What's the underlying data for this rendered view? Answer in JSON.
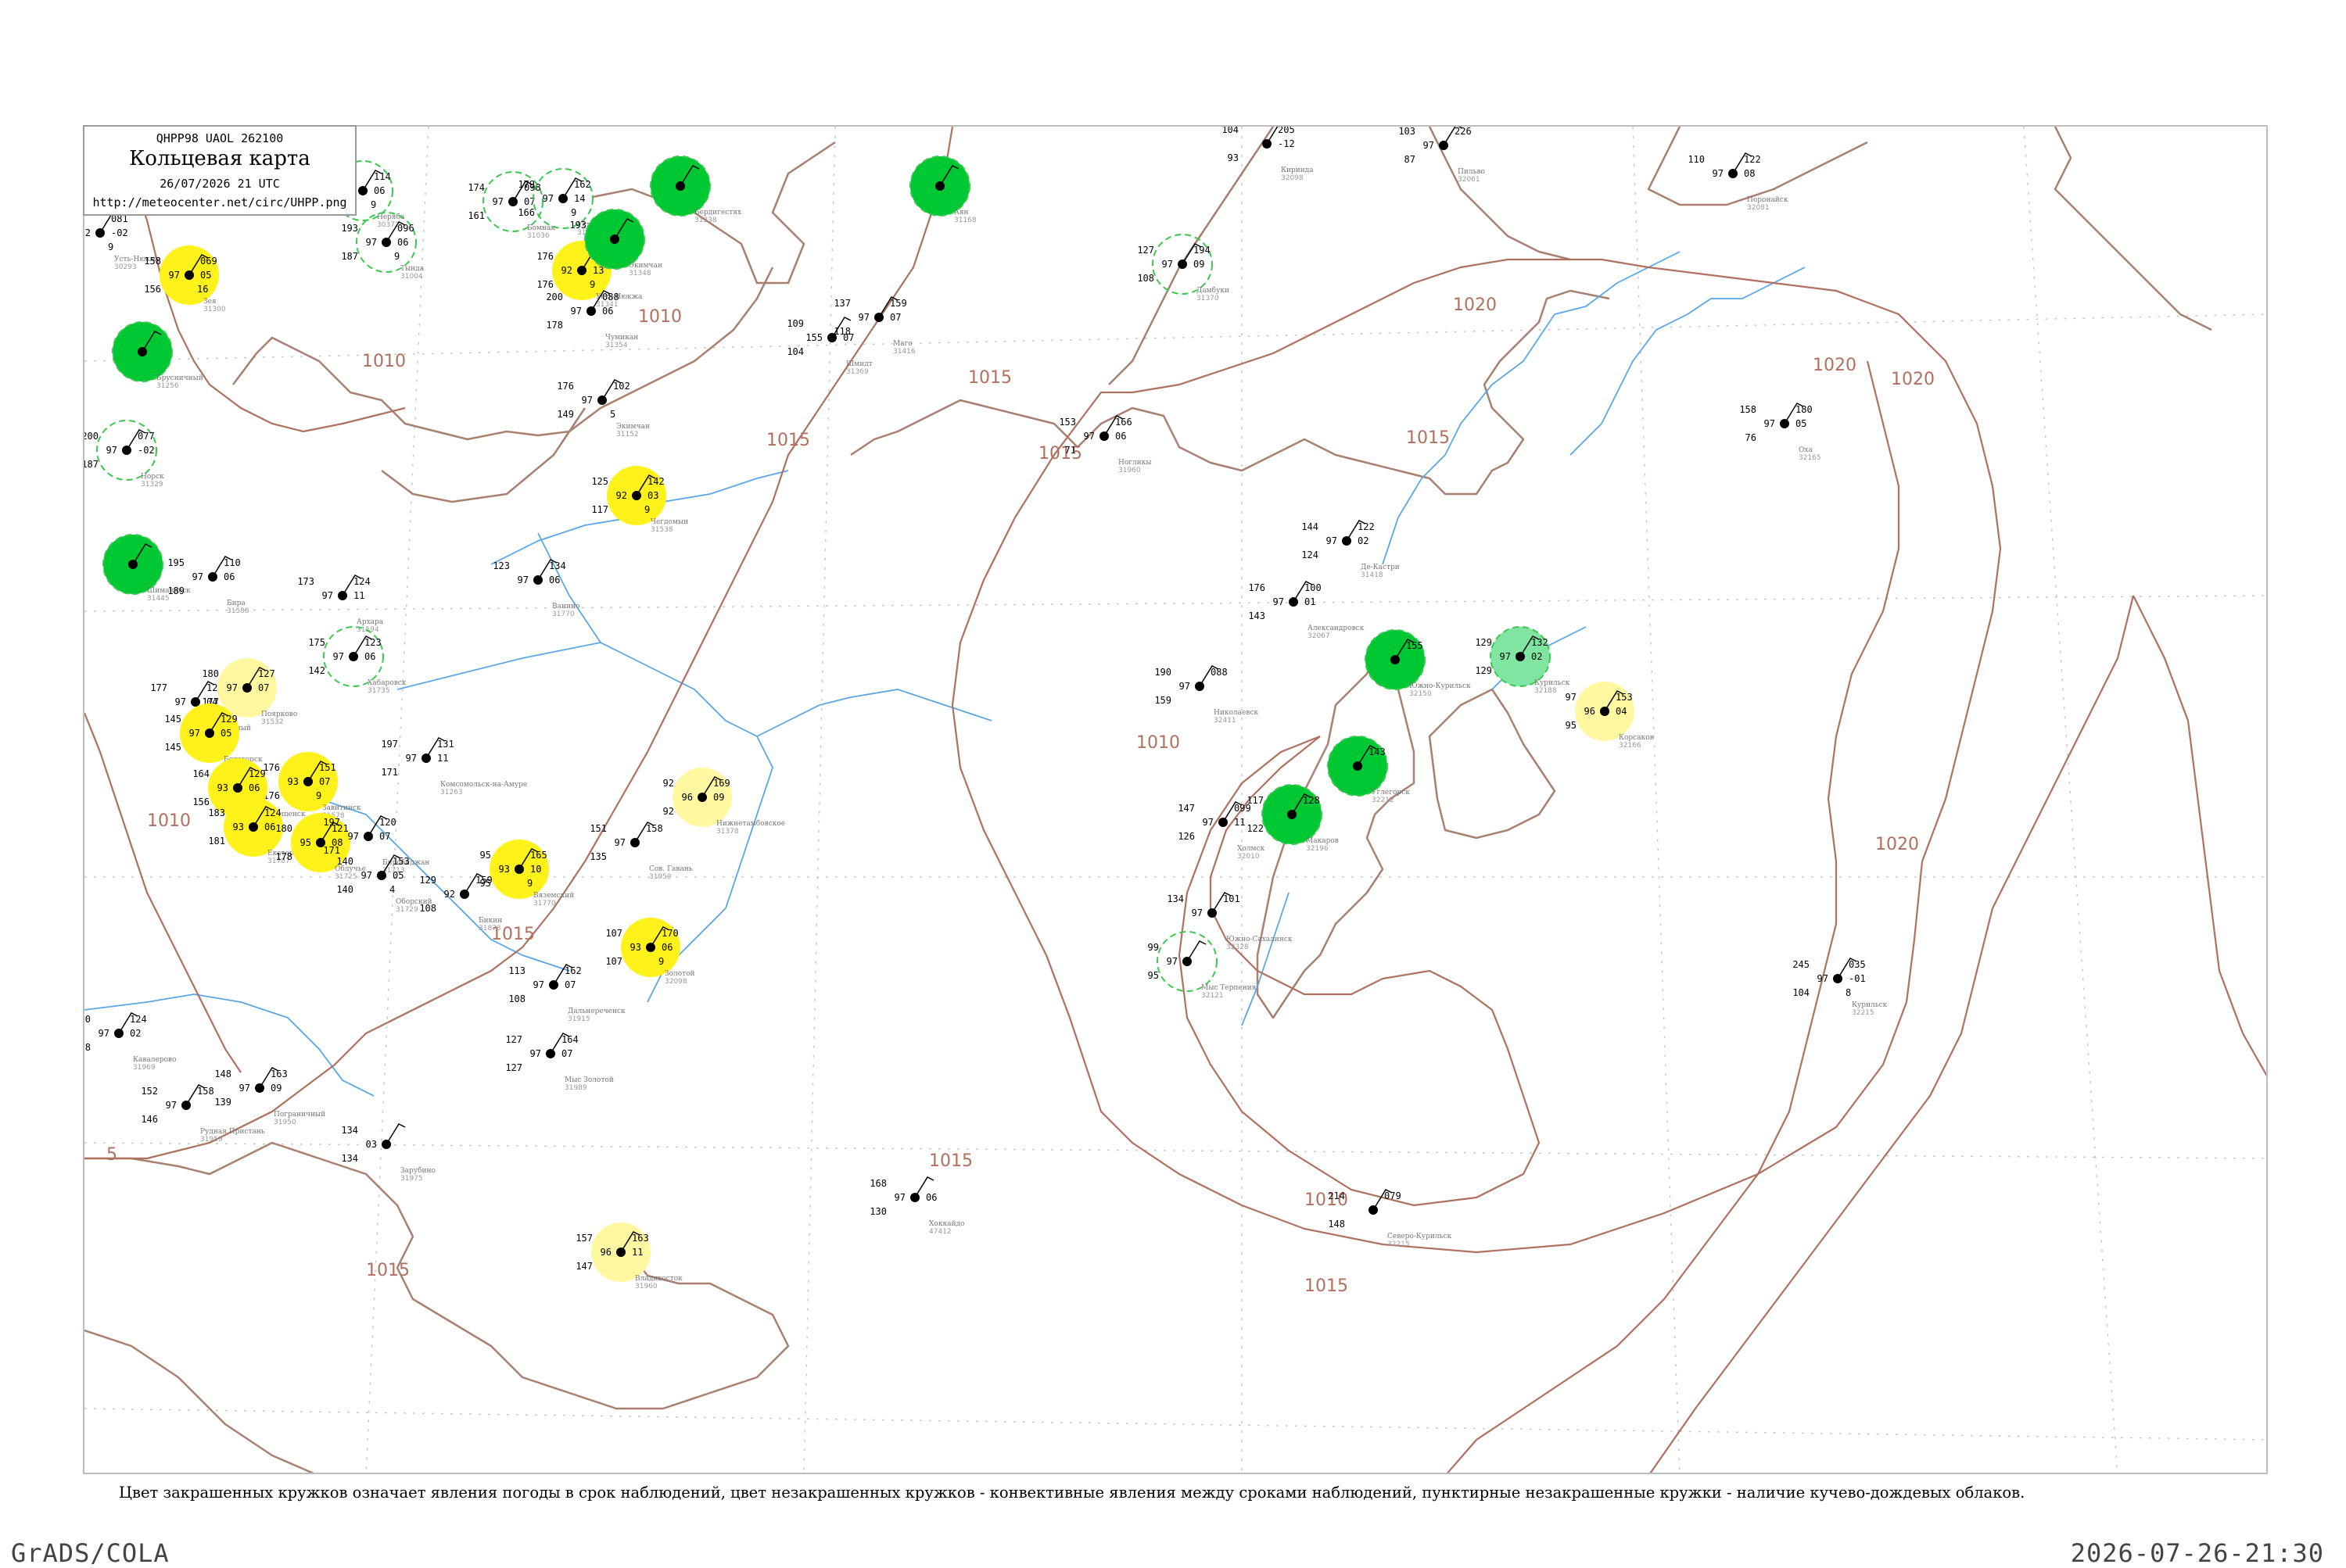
{
  "header": {
    "product_code": "QHPP98  UAOL  262100",
    "title": "Кольцевая карта",
    "datetime": "26/07/2026 21 UTC",
    "url": "http://meteocenter.net/circ/UHPP.png"
  },
  "footnote": "Цвет закрашенных кружков означает явления погоды в срок наблюдений, цвет незакрашенных кружков - конвективные явления между сроками наблюдений, пунктирные незакрашенные кружки - наличие кучево-дождевых облаков.",
  "footer": {
    "credit": "GrADS/COLA",
    "timestamp": "2026-07-26-21:30"
  },
  "colors": {
    "isobar": "#b07060",
    "coast": "#a88070",
    "river": "#5aa6e6",
    "shower": "#00c832",
    "light_shower": "#7fe5a0",
    "haze": "#fff21a",
    "light_haze": "#fff8a0",
    "cb_ring": "#3cc850",
    "grid": "#c8c8c8"
  },
  "isobar_labels": [
    "1010",
    "1015",
    "1020",
    "5"
  ],
  "stations": [
    {
      "name": "Усть-Нюкжа",
      "id": "30293",
      "t": "148",
      "p": "081",
      "td": "92",
      "dp": "-02",
      "pr": "148",
      "hw": "9",
      "mark": "none"
    },
    {
      "name": "Неряба",
      "id": "30372",
      "t": "169",
      "p": "114",
      "td": "97",
      "dp": "06",
      "pr": "163",
      "hw": "9",
      "mark": "cb"
    },
    {
      "name": "Тында",
      "id": "31004",
      "t": "193",
      "p": "096",
      "td": "97",
      "dp": "06",
      "pr": "187",
      "hw": "9",
      "mark": "cb"
    },
    {
      "name": "Бомнак",
      "id": "31036",
      "t": "174",
      "p": "098",
      "td": "97",
      "dp": "07",
      "pr": "161",
      "hw": "",
      "mark": "cb"
    },
    {
      "name": "Усть-Юдома",
      "id": "31137",
      "t": "179",
      "p": "162",
      "td": "97",
      "dp": "14",
      "pr": "166",
      "hw": "9",
      "mark": "cb"
    },
    {
      "name": "Бердигестях",
      "id": "31338",
      "t": "",
      "p": "",
      "td": "",
      "dp": "",
      "pr": "",
      "hw": "",
      "mark": "shower"
    },
    {
      "name": "Аян",
      "id": "31168",
      "t": "",
      "p": "",
      "td": "",
      "dp": "",
      "pr": "",
      "hw": "",
      "mark": "shower"
    },
    {
      "name": "Зея",
      "id": "31300",
      "t": "158",
      "p": "069",
      "td": "97",
      "dp": "05",
      "pr": "156",
      "hw": "16",
      "mark": "haze"
    },
    {
      "name": "Усть-Нюкжа",
      "id": "31341",
      "t": "176",
      "p": "086",
      "td": "92",
      "dp": "13",
      "pr": "176",
      "hw": "9",
      "mark": "haze"
    },
    {
      "name": "Экимчан",
      "id": "31348",
      "t": "193",
      "p": "",
      "td": "",
      "dp": "",
      "pr": "",
      "hw": "",
      "mark": "shower"
    },
    {
      "name": "Чумикан",
      "id": "31354",
      "t": "200",
      "p": "088",
      "td": "97",
      "dp": "06",
      "pr": "178",
      "hw": "",
      "mark": "none"
    },
    {
      "name": "Брусничный",
      "id": "31256",
      "t": "",
      "p": "",
      "td": "",
      "dp": "",
      "pr": "",
      "hw": "",
      "mark": "shower"
    },
    {
      "name": "Дамбуки",
      "id": "31370",
      "t": "127",
      "p": "194",
      "td": "97",
      "dp": "09",
      "pr": "108",
      "hw": "",
      "mark": "cb"
    },
    {
      "name": "Маго",
      "id": "31416",
      "t": "137",
      "p": "159",
      "td": "97",
      "dp": "07",
      "pr": "118",
      "hw": "",
      "mark": "none"
    },
    {
      "name": "Пильво",
      "id": "32061",
      "t": "103",
      "p": "226",
      "td": "97",
      "dp": "",
      "pr": "87",
      "hw": "",
      "mark": "none"
    },
    {
      "name": "Киринда",
      "id": "32098",
      "t": "104",
      "p": "205",
      "td": "",
      "dp": "-12",
      "pr": "93",
      "hw": "",
      "mark": "none"
    },
    {
      "name": "Поронайск",
      "id": "32081",
      "t": "110",
      "p": "122",
      "td": "97",
      "dp": "08",
      "pr": "",
      "hw": "",
      "mark": "none"
    },
    {
      "name": "Экимчан",
      "id": "31152",
      "t": "176",
      "p": "102",
      "td": "97",
      "dp": "",
      "pr": "149",
      "hw": "5",
      "mark": "none"
    },
    {
      "name": "Шмидт",
      "id": "31369",
      "t": "109",
      "p": "",
      "td": "155",
      "dp": "07",
      "pr": "104",
      "hw": "",
      "mark": "none"
    },
    {
      "name": "Ногликы",
      "id": "31960",
      "t": "153",
      "p": "166",
      "td": "97",
      "dp": "06",
      "pr": "71",
      "hw": "",
      "mark": "none"
    },
    {
      "name": "Оха",
      "id": "32165",
      "t": "158",
      "p": "180",
      "td": "97",
      "dp": "05",
      "pr": "76",
      "hw": "",
      "mark": "none"
    },
    {
      "name": "Норск",
      "id": "31329",
      "t": "200",
      "p": "077",
      "td": "97",
      "dp": "-02",
      "pr": "187",
      "hw": "",
      "mark": "cb"
    },
    {
      "name": "Шимановск",
      "id": "31445",
      "t": "",
      "p": "",
      "td": "",
      "dp": "",
      "pr": "",
      "hw": "",
      "mark": "shower"
    },
    {
      "name": "Чегдомын",
      "id": "31538",
      "t": "125",
      "p": "142",
      "td": "92",
      "dp": "03",
      "pr": "117",
      "hw": "9",
      "mark": "haze"
    },
    {
      "name": "Ванино",
      "id": "31770",
      "t": "123",
      "p": "134",
      "td": "97",
      "dp": "06",
      "pr": "",
      "hw": "",
      "mark": "none"
    },
    {
      "name": "Бира",
      "id": "31588",
      "t": "195",
      "p": "110",
      "td": "97",
      "dp": "06",
      "pr": "189",
      "hw": "",
      "mark": "none"
    },
    {
      "name": "Архара",
      "id": "31594",
      "t": "173",
      "p": "124",
      "td": "97",
      "dp": "11",
      "pr": "",
      "hw": "",
      "mark": "none"
    },
    {
      "name": "Хабаровск",
      "id": "31735",
      "t": "175",
      "p": "123",
      "td": "97",
      "dp": "06",
      "pr": "142",
      "hw": "",
      "mark": "cb"
    },
    {
      "name": "Де-Кастри",
      "id": "31418",
      "t": "144",
      "p": "122",
      "td": "97",
      "dp": "02",
      "pr": "124",
      "hw": "",
      "mark": "none"
    },
    {
      "name": "Александровск",
      "id": "32067",
      "t": "176",
      "p": "100",
      "td": "97",
      "dp": "01",
      "pr": "143",
      "hw": "",
      "mark": "none"
    },
    {
      "name": "Южно-Курильск",
      "id": "32150",
      "t": "",
      "p": "155",
      "td": "",
      "dp": "",
      "pr": "",
      "hw": "",
      "mark": "shower"
    },
    {
      "name": "Курильск",
      "id": "32188",
      "t": "129",
      "p": "132",
      "td": "97",
      "dp": "02",
      "pr": "129",
      "hw": "",
      "mark": "light_shower"
    },
    {
      "name": "Корсаков",
      "id": "32166",
      "t": "97",
      "p": "153",
      "td": "96",
      "dp": "04",
      "pr": "95",
      "hw": "",
      "mark": "light_haze"
    },
    {
      "name": "Николаевск",
      "id": "32411",
      "t": "190",
      "p": "088",
      "td": "97",
      "dp": "",
      "pr": "159",
      "hw": "",
      "mark": "none"
    },
    {
      "name": "Углегорск",
      "id": "32212",
      "t": "",
      "p": "143",
      "td": "",
      "dp": "",
      "pr": "",
      "hw": "",
      "mark": "shower"
    },
    {
      "name": "Макаров",
      "id": "32196",
      "t": "117",
      "p": "128",
      "td": "",
      "dp": "",
      "pr": "122",
      "hw": "",
      "mark": "shower"
    },
    {
      "name": "Холмск",
      "id": "32010",
      "t": "147",
      "p": "099",
      "td": "97",
      "dp": "11",
      "pr": "126",
      "hw": "",
      "mark": "none"
    },
    {
      "name": "Южно-Сахалинск",
      "id": "32328",
      "t": "134",
      "p": "101",
      "td": "97",
      "dp": "",
      "pr": "",
      "hw": "",
      "mark": "none"
    },
    {
      "name": "Свободный",
      "id": "31510",
      "t": "177",
      "p": "124",
      "td": "97",
      "dp": "04",
      "pr": "",
      "hw": "",
      "mark": "none"
    },
    {
      "name": "Поярково",
      "id": "31532",
      "t": "180",
      "p": "127",
      "td": "97",
      "dp": "07",
      "pr": "177",
      "hw": "",
      "mark": "light_haze"
    },
    {
      "name": "Белогорск",
      "id": "31572",
      "t": "145",
      "p": "129",
      "td": "97",
      "dp": "05",
      "pr": "145",
      "hw": "",
      "mark": "haze"
    },
    {
      "name": "Завитинск",
      "id": "31578",
      "t": "176",
      "p": "151",
      "td": "93",
      "dp": "07",
      "pr": "176",
      "hw": "9",
      "mark": "haze"
    },
    {
      "name": "Благовещенск",
      "id": "31510",
      "t": "164",
      "p": "129",
      "td": "93",
      "dp": "06",
      "pr": "156",
      "hw": "",
      "mark": "haze"
    },
    {
      "name": "Екатеринославка",
      "id": "31707",
      "t": "183",
      "p": "124",
      "td": "93",
      "dp": "06",
      "pr": "181",
      "hw": "",
      "mark": "haze"
    },
    {
      "name": "Облучье",
      "id": "31725",
      "t": "180",
      "p": "121",
      "td": "95",
      "dp": "08",
      "pr": "178",
      "hw": "",
      "mark": "haze"
    },
    {
      "name": "Биробиджан",
      "id": "31713",
      "t": "197",
      "p": "120",
      "td": "97",
      "dp": "07",
      "pr": "171",
      "hw": "",
      "mark": "none"
    },
    {
      "name": "Комсомольск-на-Амуре",
      "id": "31263",
      "t": "197",
      "p": "131",
      "td": "97",
      "dp": "11",
      "pr": "171",
      "hw": "",
      "mark": "none"
    },
    {
      "name": "Оборский",
      "id": "31729",
      "t": "140",
      "p": "153",
      "td": "97",
      "dp": "05",
      "pr": "140",
      "hw": "4",
      "mark": "none"
    },
    {
      "name": "Вяземский",
      "id": "31770",
      "t": "95",
      "p": "165",
      "td": "93",
      "dp": "10",
      "pr": "95",
      "hw": "9",
      "mark": "haze"
    },
    {
      "name": "Бикин",
      "id": "31873",
      "t": "129",
      "p": "159",
      "td": "92",
      "dp": "",
      "pr": "108",
      "hw": "",
      "mark": "none"
    },
    {
      "name": "Нижнетамбовское",
      "id": "31378",
      "t": "92",
      "p": "169",
      "td": "96",
      "dp": "09",
      "pr": "92",
      "hw": "",
      "mark": "light_haze"
    },
    {
      "name": "Сов. Гавань",
      "id": "31959",
      "t": "151",
      "p": "158",
      "td": "97",
      "dp": "",
      "pr": "135",
      "hw": "",
      "mark": "none"
    },
    {
      "name": "Золотой",
      "id": "32098",
      "t": "107",
      "p": "170",
      "td": "93",
      "dp": "06",
      "pr": "107",
      "hw": "9",
      "mark": "haze"
    },
    {
      "name": "Дальнереченск",
      "id": "31915",
      "t": "113",
      "p": "162",
      "td": "97",
      "dp": "07",
      "pr": "108",
      "hw": "",
      "mark": "none"
    },
    {
      "name": "Мыс Золотой",
      "id": "31989",
      "t": "127",
      "p": "164",
      "td": "97",
      "dp": "07",
      "pr": "127",
      "hw": "",
      "mark": "none"
    },
    {
      "name": "Кавалерово",
      "id": "31969",
      "t": "190",
      "p": "124",
      "td": "97",
      "dp": "02",
      "pr": "168",
      "hw": "",
      "mark": "none"
    },
    {
      "name": "Пограничный",
      "id": "31950",
      "t": "148",
      "p": "163",
      "td": "97",
      "dp": "09",
      "pr": "139",
      "hw": "",
      "mark": "none"
    },
    {
      "name": "Рудная Пристань",
      "id": "31959",
      "t": "152",
      "p": "158",
      "td": "97",
      "dp": "",
      "pr": "146",
      "hw": "",
      "mark": "none"
    },
    {
      "name": "Владивосток",
      "id": "31960",
      "t": "157",
      "p": "163",
      "td": "96",
      "dp": "11",
      "pr": "147",
      "hw": "",
      "mark": "light_haze"
    },
    {
      "name": "Хоккайдо",
      "id": "47412",
      "t": "168",
      "p": "",
      "td": "97",
      "dp": "06",
      "pr": "130",
      "hw": "",
      "mark": "none"
    },
    {
      "name": "Мыс Терпения",
      "id": "32121",
      "t": "99",
      "p": "",
      "td": "97",
      "dp": "",
      "pr": "95",
      "hw": "",
      "mark": "cb"
    },
    {
      "name": "Курильск",
      "id": "32215",
      "t": "245",
      "p": "035",
      "td": "97",
      "dp": "-01",
      "pr": "104",
      "hw": "8",
      "mark": "none"
    },
    {
      "name": "Северо-Курильск",
      "id": "32215",
      "t": "214",
      "p": "079",
      "td": "",
      "dp": "",
      "pr": "148",
      "hw": "",
      "mark": "none"
    },
    {
      "name": "Зарубино",
      "id": "31975",
      "t": "134",
      "p": "",
      "td": "03",
      "dp": "",
      "pr": "134",
      "hw": "",
      "mark": "none"
    }
  ]
}
